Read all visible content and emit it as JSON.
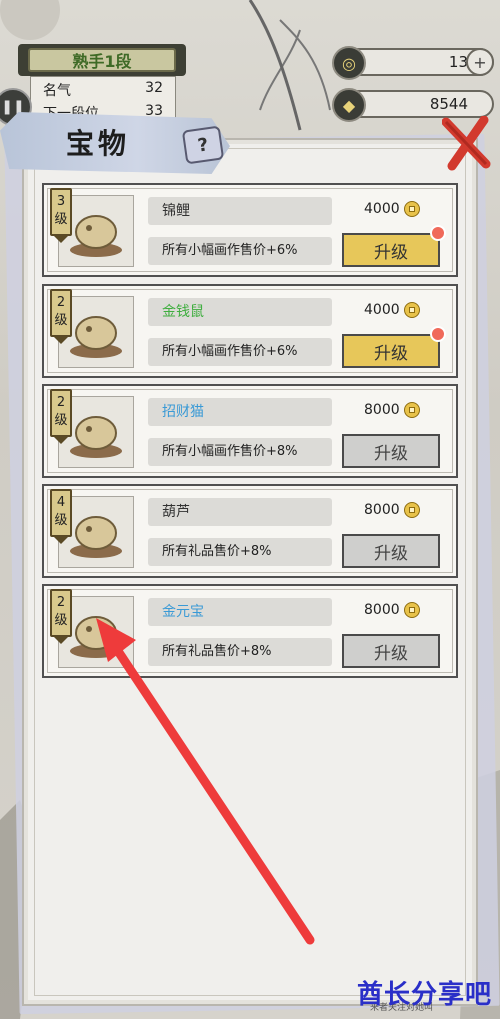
{
  "hud": {
    "rank": "熟手1段",
    "stats": [
      {
        "label": "名气",
        "value": "32"
      },
      {
        "label": "下一段位",
        "value": "33"
      }
    ],
    "resource_top": {
      "value": "13",
      "icon": "ink-swirl-icon"
    },
    "resource_coins": {
      "value": "8544",
      "icon": "coin-icon"
    },
    "plus": "+"
  },
  "panel": {
    "title": "宝物",
    "help": "?",
    "items": [
      {
        "level": "3\n级",
        "name": "锦鲤",
        "name_color": "#333333",
        "desc": "所有小幅画作售价+6%",
        "price": "4000",
        "button": "升级",
        "active": true,
        "dot": true
      },
      {
        "level": "2\n级",
        "name": "金钱鼠",
        "name_color": "#3fae3f",
        "desc": "所有小幅画作售价+6%",
        "price": "4000",
        "button": "升级",
        "active": true,
        "dot": true
      },
      {
        "level": "2\n级",
        "name": "招财猫",
        "name_color": "#3a9ad6",
        "desc": "所有小幅画作售价+8%",
        "price": "8000",
        "button": "升级",
        "active": false,
        "dot": false
      },
      {
        "level": "4\n级",
        "name": "葫芦",
        "name_color": "#333333",
        "desc": "所有礼品售价+8%",
        "price": "8000",
        "button": "升级",
        "active": false,
        "dot": false
      },
      {
        "level": "2\n级",
        "name": "金元宝",
        "name_color": "#3a9ad6",
        "desc": "所有礼品售价+8%",
        "price": "8000",
        "button": "升级",
        "active": false,
        "dot": false
      }
    ]
  },
  "watermark": "酋长分享吧",
  "watermark_small": "来者关注对她叫",
  "colors": {
    "accent_gold": "#e7c75a",
    "alert_red": "#f06a5a",
    "arrow_red": "#ee3b3b"
  }
}
